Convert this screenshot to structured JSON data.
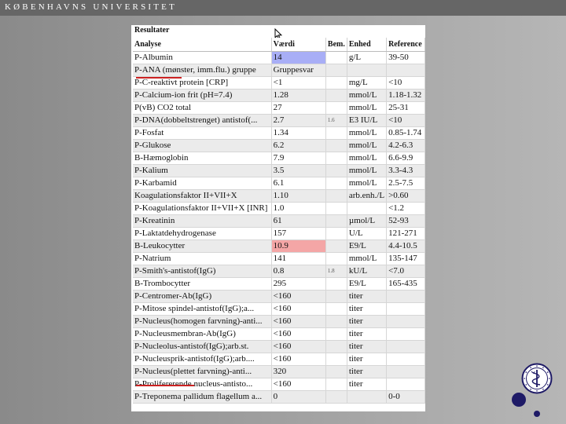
{
  "banner": {
    "university": "KØBENHAVNS UNIVERSITET"
  },
  "panel": {
    "title": "Resultater"
  },
  "table": {
    "headers": {
      "analyse": "Analyse",
      "vaerdi": "Værdi",
      "bem": "Bem.",
      "enhed": "Enhed",
      "reference": "Reference"
    },
    "rows": [
      {
        "analyse": "P-Albumin",
        "vaerdi": "14",
        "bem": "",
        "enhed": "g/L",
        "reference": "39-50",
        "highlight": "blue"
      },
      {
        "analyse": "P-ANA (mønster, imm.flu.) gruppe",
        "vaerdi": "Gruppesvar",
        "bem": "",
        "enhed": "",
        "reference": ""
      },
      {
        "analyse": "P-C-reaktivt protein [CRP]",
        "vaerdi": "<1",
        "bem": "",
        "enhed": "mg/L",
        "reference": "<10"
      },
      {
        "analyse": "P-Calcium-ion frit (pH=7.4)",
        "vaerdi": "1.28",
        "bem": "",
        "enhed": "mmol/L",
        "reference": "1.18-1.32"
      },
      {
        "analyse": "P(vB) CO2 total",
        "vaerdi": "27",
        "bem": "",
        "enhed": "mmol/L",
        "reference": "25-31"
      },
      {
        "analyse": "P-DNA(dobbeltstrenget) antistof(...",
        "vaerdi": "2.7",
        "bem": "1.6",
        "enhed": "E3 IU/L",
        "reference": "<10"
      },
      {
        "analyse": "P-Fosfat",
        "vaerdi": "1.34",
        "bem": "",
        "enhed": "mmol/L",
        "reference": "0.85-1.74"
      },
      {
        "analyse": "P-Glukose",
        "vaerdi": "6.2",
        "bem": "",
        "enhed": "mmol/L",
        "reference": "4.2-6.3"
      },
      {
        "analyse": "B-Hæmoglobin",
        "vaerdi": "7.9",
        "bem": "",
        "enhed": "mmol/L",
        "reference": "6.6-9.9"
      },
      {
        "analyse": "P-Kalium",
        "vaerdi": "3.5",
        "bem": "",
        "enhed": "mmol/L",
        "reference": "3.3-4.3"
      },
      {
        "analyse": "P-Karbamid",
        "vaerdi": "6.1",
        "bem": "",
        "enhed": "mmol/L",
        "reference": "2.5-7.5"
      },
      {
        "analyse": "Koagulationsfaktor II+VII+X",
        "vaerdi": "1.10",
        "bem": "",
        "enhed": "arb.enh./L",
        "reference": ">0.60"
      },
      {
        "analyse": "P-Koagulationsfaktor II+VII+X [INR]",
        "vaerdi": "1.0",
        "bem": "",
        "enhed": "",
        "reference": "<1.2"
      },
      {
        "analyse": "P-Kreatinin",
        "vaerdi": "61",
        "bem": "",
        "enhed": "µmol/L",
        "reference": "52-93"
      },
      {
        "analyse": "P-Laktatdehydrogenase",
        "vaerdi": "157",
        "bem": "",
        "enhed": "U/L",
        "reference": "121-271"
      },
      {
        "analyse": "B-Leukocytter",
        "vaerdi": "10.9",
        "bem": "",
        "enhed": "E9/L",
        "reference": "4.4-10.5",
        "highlight": "red"
      },
      {
        "analyse": "P-Natrium",
        "vaerdi": "141",
        "bem": "",
        "enhed": "mmol/L",
        "reference": "135-147"
      },
      {
        "analyse": "P-Smith's-antistof(IgG)",
        "vaerdi": "0.8",
        "bem": "1.8",
        "enhed": "kU/L",
        "reference": "<7.0"
      },
      {
        "analyse": "B-Trombocytter",
        "vaerdi": "295",
        "bem": "",
        "enhed": "E9/L",
        "reference": "165-435"
      },
      {
        "analyse": "P-Centromer-Ab(IgG)",
        "vaerdi": "<160",
        "bem": "",
        "enhed": "titer",
        "reference": ""
      },
      {
        "analyse": "P-Mitose spindel-antistof(IgG);a...",
        "vaerdi": "<160",
        "bem": "",
        "enhed": "titer",
        "reference": ""
      },
      {
        "analyse": "P-Nucleus(homogen farvning)-anti...",
        "vaerdi": "<160",
        "bem": "",
        "enhed": "titer",
        "reference": ""
      },
      {
        "analyse": "P-Nucleusmembran-Ab(IgG)",
        "vaerdi": "<160",
        "bem": "",
        "enhed": "titer",
        "reference": ""
      },
      {
        "analyse": "P-Nucleolus-antistof(IgG);arb.st.",
        "vaerdi": "<160",
        "bem": "",
        "enhed": "titer",
        "reference": ""
      },
      {
        "analyse": "P-Nucleusprik-antistof(IgG);arb....",
        "vaerdi": "<160",
        "bem": "",
        "enhed": "titer",
        "reference": ""
      },
      {
        "analyse": "P-Nucleus(plettet farvning)-anti...",
        "vaerdi": "320",
        "bem": "",
        "enhed": "titer",
        "reference": ""
      },
      {
        "analyse": "P-Prolifererende nucleus-antisto...",
        "vaerdi": "<160",
        "bem": "",
        "enhed": "titer",
        "reference": ""
      },
      {
        "analyse": "P-Treponema pallidum flagellum a...",
        "vaerdi": "0",
        "bem": "",
        "enhed": "",
        "reference": "0-0"
      }
    ]
  },
  "colors": {
    "highlight_low": "#a8aef6",
    "highlight_high": "#f4a6a6",
    "annotation_underline": "#cc2222",
    "logo_blue": "#1e1a66"
  },
  "icons": {
    "cursor": "mouse-pointer-icon",
    "logo": "university-seal-icon"
  }
}
